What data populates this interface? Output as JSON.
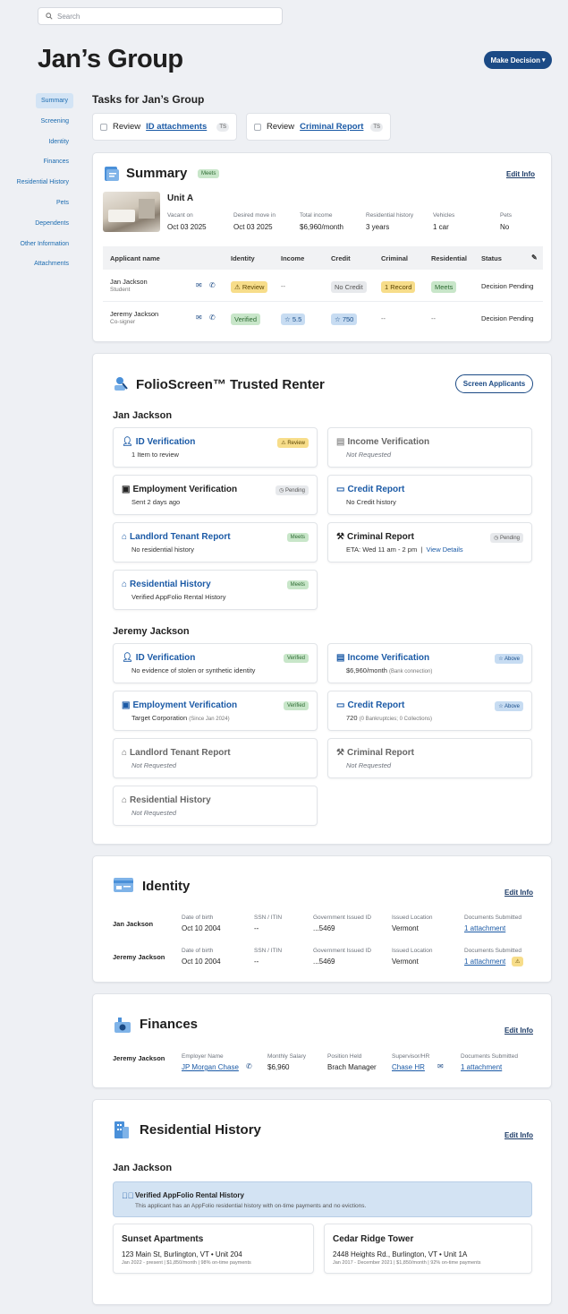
{
  "search": {
    "placeholder": "Search"
  },
  "page": {
    "title": "Jan’s Group",
    "decision_label": "Make Decision"
  },
  "nav": [
    "Summary",
    "Screening",
    "Identity",
    "Finances",
    "Residential History",
    "Pets",
    "Dependents",
    "Other Information",
    "Attachments"
  ],
  "tasks": {
    "title": "Tasks for Jan’s Group",
    "items": [
      {
        "prefix": "Review",
        "link": "ID attachments",
        "initials": "TS"
      },
      {
        "prefix": "Review",
        "link": "Criminal Report",
        "initials": "TS"
      }
    ]
  },
  "summary": {
    "title": "Summary",
    "badge": "Meets",
    "edit": "Edit Info",
    "unit": "Unit A",
    "facts": [
      {
        "label": "Vacant on",
        "value": "Oct 03 2025"
      },
      {
        "label": "Desired move in",
        "value": "Oct 03 2025"
      },
      {
        "label": "Total income",
        "value": "$6,960/month"
      },
      {
        "label": "Residential history",
        "value": "3 years"
      },
      {
        "label": "Vehicles",
        "value": "1 car"
      },
      {
        "label": "Pets",
        "value": "No"
      }
    ],
    "columns": [
      "Applicant name",
      "Identity",
      "Income",
      "Credit",
      "Criminal",
      "Residential",
      "Status"
    ],
    "rows": [
      {
        "name": "Jan Jackson",
        "role": "Student",
        "identity": "Review",
        "income": "--",
        "credit": "No Credit",
        "criminal": "1 Record",
        "residential": "Meets",
        "status": "Decision Pending"
      },
      {
        "name": "Jeremy Jackson",
        "role": "Co-signer",
        "identity": "Verified",
        "income": "5.5",
        "credit": "750",
        "criminal": "--",
        "residential": "--",
        "status": "Decision Pending"
      }
    ]
  },
  "screening": {
    "title": "FolioScreen™ Trusted Renter",
    "button": "Screen Applicants",
    "jan": {
      "name": "Jan Jackson",
      "cards": [
        {
          "title": "ID Verification",
          "sub": "1 Item to review",
          "badge": "Review"
        },
        {
          "title": "Income Verification",
          "sub": "Not Requested"
        },
        {
          "title": "Employment Verification",
          "sub": "Sent 2 days ago",
          "badge": "Pending"
        },
        {
          "title": "Credit Report",
          "sub": "No Credit history"
        },
        {
          "title": "Landlord Tenant Report",
          "sub": "No residential history",
          "badge": "Meets"
        },
        {
          "title": "Criminal Report",
          "sub": "ETA: Wed 11 am - 2 pm",
          "link": "View Details",
          "badge": "Pending"
        },
        {
          "title": "Residential History",
          "sub": "Verified AppFolio Rental History",
          "badge": "Meets"
        }
      ]
    },
    "jeremy": {
      "name": "Jeremy Jackson",
      "cards": [
        {
          "title": "ID Verification",
          "sub": "No evidence of stolen or synthetic identity",
          "badge": "Verified"
        },
        {
          "title": "Income Verification",
          "sub": "$6,960/month",
          "note": "(Bank connection)",
          "badge": "Above"
        },
        {
          "title": "Employment Verification",
          "sub": "Target Corporation",
          "note": "(Since Jan 2024)",
          "badge": "Verified"
        },
        {
          "title": "Credit Report",
          "sub": "720",
          "note": "(0 Bankruptcies; 0 Collections)",
          "badge": "Above"
        },
        {
          "title": "Landlord Tenant Report",
          "sub": "Not Requested"
        },
        {
          "title": "Criminal Report",
          "sub": "Not Requested"
        },
        {
          "title": "Residential History",
          "sub": "Not Requested"
        }
      ]
    }
  },
  "identity": {
    "title": "Identity",
    "edit": "Edit Info",
    "labels": [
      "Date of birth",
      "SSN / ITIN",
      "Government Issued ID",
      "Issued Location",
      "Documents Submitted"
    ],
    "rows": [
      {
        "name": "Jan Jackson",
        "dob": "Oct 10 2004",
        "ssn": "--",
        "gov": "...5469",
        "loc": "Vermont",
        "docs": "1 attachment"
      },
      {
        "name": "Jeremy Jackson",
        "dob": "Oct 10 2004",
        "ssn": "--",
        "gov": "...5469",
        "loc": "Vermont",
        "docs": "1 attachment"
      }
    ]
  },
  "finances": {
    "title": "Finances",
    "edit": "Edit Info",
    "name": "Jeremy Jackson",
    "labels": [
      "Employer Name",
      "Monthly Salary",
      "Position Held",
      "Supervisor/HR",
      "Documents Submitted"
    ],
    "employer": "JP Morgan Chase",
    "salary": "$6,960",
    "position": "Brach Manager",
    "supervisor": "Chase HR",
    "docs": "1 attachment"
  },
  "residential": {
    "title": "Residential History",
    "edit": "Edit Info",
    "name": "Jan Jackson",
    "verified_title": "Verified AppFolio Rental History",
    "verified_text": "This applicant has an AppFolio residential history with on-time payments and no evictions.",
    "places": [
      {
        "name": "Sunset Apartments",
        "address": "123 Main St, Burlington, VT • Unit 204",
        "detail": "Jan 2022 - present | $1,850/month | 98% on-time payments"
      },
      {
        "name": "Cedar Ridge Tower",
        "address": "2448 Heights Rd., Burlington, VT • Unit 1A",
        "detail": "Jan 2017 - December 2021 | $1,850/month | 92% on-time payments"
      }
    ]
  },
  "colors": {
    "accent": "#1b4a85",
    "link": "#1b5aa6",
    "meets": "#c8e6c9",
    "review": "#f7dd8a"
  }
}
